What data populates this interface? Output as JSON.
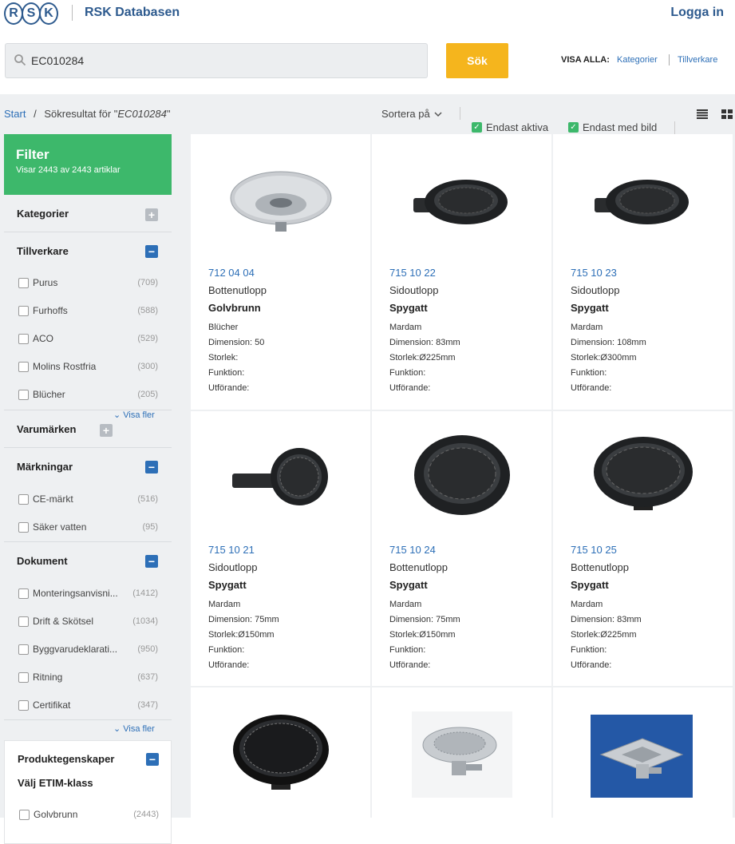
{
  "header": {
    "logo_letters": [
      "R",
      "S",
      "K"
    ],
    "brand": "RSK Databasen",
    "login": "Logga in",
    "search_value": "EC010284",
    "search_button": "Sök",
    "visa_alla": "VISA ALLA:",
    "visa_links": [
      "Kategorier",
      "Tillverkare"
    ]
  },
  "toolbar": {
    "crumb_start": "Start",
    "crumb_sep": "/",
    "crumb_text": "Sökresultat för \"",
    "crumb_query": "EC010284",
    "crumb_end": "\"",
    "sort": "Sortera på",
    "only_active": "Endast aktiva",
    "only_image": "Endast med bild"
  },
  "filter": {
    "title": "Filter",
    "subtitle": "Visar 2443 av 2443 artiklar"
  },
  "sections": {
    "kategorier": "Kategorier",
    "tillverkare": "Tillverkare",
    "tillverkare_items": [
      {
        "label": "Purus",
        "count": "(709)"
      },
      {
        "label": "Furhoffs",
        "count": "(588)"
      },
      {
        "label": "ACO",
        "count": "(529)"
      },
      {
        "label": "Molins Rostfria",
        "count": "(300)"
      },
      {
        "label": "Blücher",
        "count": "(205)"
      }
    ],
    "visa_fler": "Visa fler",
    "varumarken": "Varumärken",
    "markningar": "Märkningar",
    "markningar_items": [
      {
        "label": "CE-märkt",
        "count": "(516)"
      },
      {
        "label": "Säker vatten",
        "count": "(95)"
      }
    ],
    "dokument": "Dokument",
    "dokument_items": [
      {
        "label": "Monteringsanvisni...",
        "count": "(1412)"
      },
      {
        "label": "Drift & Skötsel",
        "count": "(1034)"
      },
      {
        "label": "Byggvarudeklarati...",
        "count": "(950)"
      },
      {
        "label": "Ritning",
        "count": "(637)"
      },
      {
        "label": "Certifikat",
        "count": "(347)"
      }
    ],
    "produkt": "Produktegenskaper",
    "etim": "Välj ETIM-klass",
    "etim_items": [
      {
        "label": "Golvbrunn",
        "count": "(2443)"
      }
    ]
  },
  "products": [
    {
      "number": "712 04 04",
      "type": "Bottenutlopp",
      "category": "Golvbrunn",
      "maker": "Blücher",
      "dimension": "Dimension: 50",
      "size": "Storlek:",
      "function": "Funktion:",
      "design": "Utförande:"
    },
    {
      "number": "715 10 22",
      "type": "Sidoutlopp",
      "category": "Spygatt",
      "maker": "Mardam",
      "dimension": "Dimension: 83mm",
      "size": "Storlek:Ø225mm",
      "function": "Funktion:",
      "design": "Utförande:"
    },
    {
      "number": "715 10 23",
      "type": "Sidoutlopp",
      "category": "Spygatt",
      "maker": "Mardam",
      "dimension": "Dimension: 108mm",
      "size": "Storlek:Ø300mm",
      "function": "Funktion:",
      "design": "Utförande:"
    },
    {
      "number": "715 10 21",
      "type": "Sidoutlopp",
      "category": "Spygatt",
      "maker": "Mardam",
      "dimension": "Dimension: 75mm",
      "size": "Storlek:Ø150mm",
      "function": "Funktion:",
      "design": "Utförande:"
    },
    {
      "number": "715 10 24",
      "type": "Bottenutlopp",
      "category": "Spygatt",
      "maker": "Mardam",
      "dimension": "Dimension: 75mm",
      "size": "Storlek:Ø150mm",
      "function": "Funktion:",
      "design": "Utförande:"
    },
    {
      "number": "715 10 25",
      "type": "Bottenutlopp",
      "category": "Spygatt",
      "maker": "Mardam",
      "dimension": "Dimension: 83mm",
      "size": "Storlek:Ø225mm",
      "function": "Funktion:",
      "design": "Utförande:"
    }
  ],
  "colors": {
    "accent": "#2d6fb7",
    "filter_green": "#3db86b",
    "search_button": "#f5b51d"
  }
}
